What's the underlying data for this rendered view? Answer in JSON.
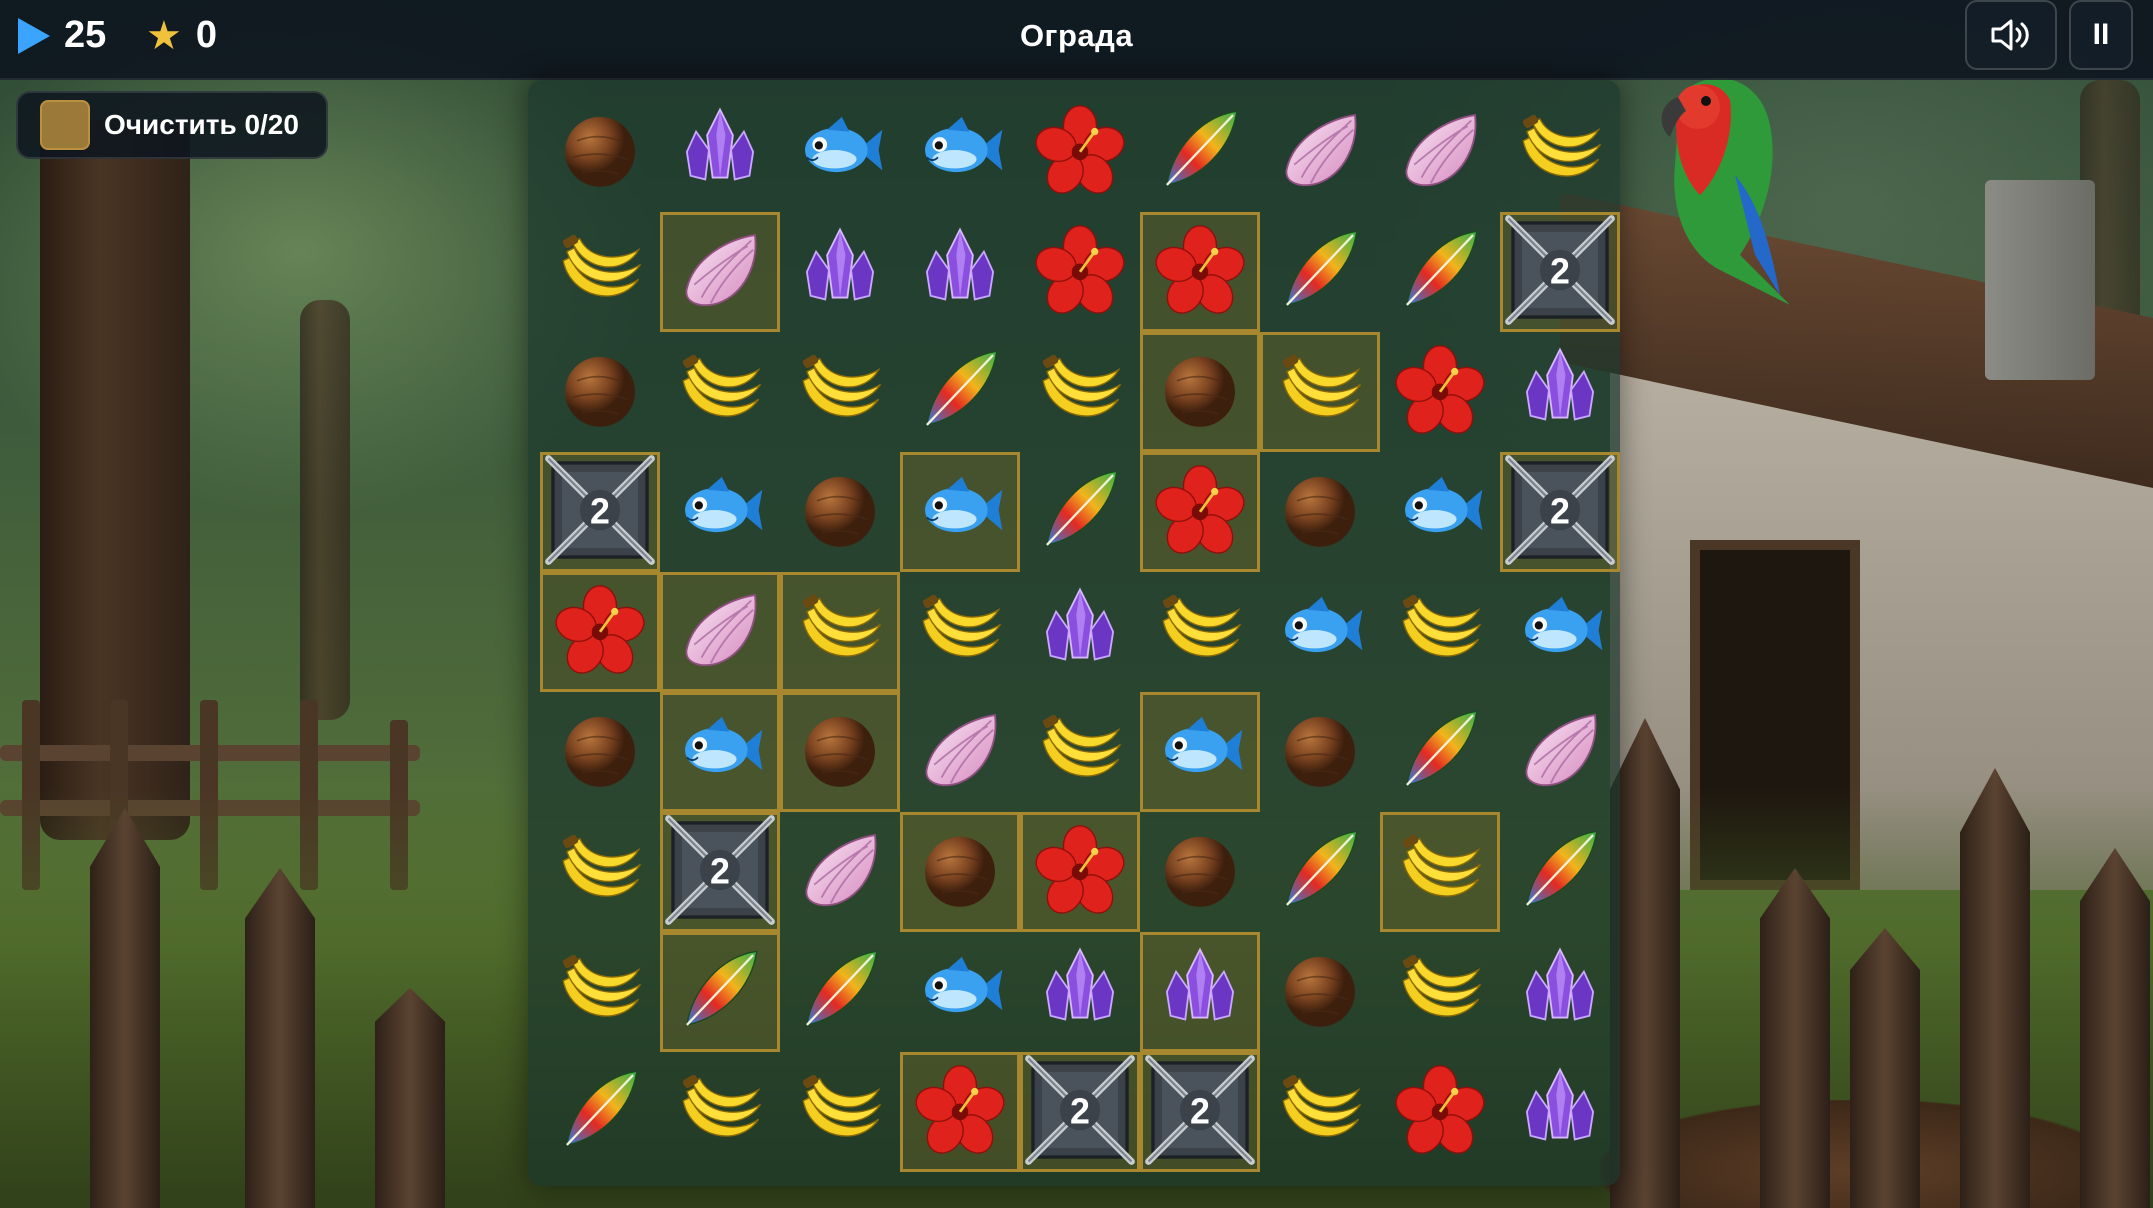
{
  "header": {
    "moves": "25",
    "moves_icon": "play-icon",
    "score": "0",
    "score_icon": "star-icon",
    "level_title": "Ограда",
    "sound_icon": "speaker-icon",
    "pause_label": "II"
  },
  "goal": {
    "label": "Очистить 0/20",
    "swatch_color": "#9b7a39"
  },
  "board": {
    "rows": 9,
    "cols": 9,
    "grid": [
      [
        "coconut",
        "crystal",
        "fish",
        "fish",
        "hibiscus",
        "feather",
        "shell",
        "shell",
        "banana"
      ],
      [
        "banana",
        "shell",
        "crystal",
        "crystal",
        "hibiscus",
        "hibiscus",
        "feather",
        "feather",
        "chain"
      ],
      [
        "coconut",
        "banana",
        "banana",
        "feather",
        "banana",
        "coconut",
        "banana",
        "hibiscus",
        "crystal"
      ],
      [
        "chain",
        "fish",
        "coconut",
        "fish",
        "feather",
        "hibiscus",
        "coconut",
        "fish",
        "chain"
      ],
      [
        "hibiscus",
        "shell",
        "banana",
        "banana",
        "crystal",
        "banana",
        "fish",
        "banana",
        "fish"
      ],
      [
        "coconut",
        "fish",
        "coconut",
        "shell",
        "banana",
        "fish",
        "coconut",
        "feather",
        "shell"
      ],
      [
        "banana",
        "chain",
        "shell",
        "coconut",
        "hibiscus",
        "coconut",
        "feather",
        "banana",
        "feather"
      ],
      [
        "banana",
        "feather",
        "feather",
        "fish",
        "crystal",
        "crystal",
        "coconut",
        "banana",
        "crystal"
      ],
      [
        "feather",
        "banana",
        "banana",
        "hibiscus",
        "chain",
        "chain",
        "banana",
        "hibiscus",
        "crystal"
      ]
    ],
    "fenced": [
      [
        0,
        0,
        0,
        0,
        0,
        0,
        0,
        0,
        0
      ],
      [
        0,
        1,
        0,
        0,
        0,
        1,
        0,
        0,
        1
      ],
      [
        0,
        0,
        0,
        0,
        0,
        1,
        1,
        0,
        0
      ],
      [
        1,
        0,
        0,
        1,
        0,
        1,
        0,
        0,
        1
      ],
      [
        1,
        1,
        1,
        0,
        0,
        0,
        0,
        0,
        0
      ],
      [
        0,
        1,
        1,
        0,
        0,
        1,
        0,
        0,
        0
      ],
      [
        0,
        1,
        0,
        1,
        1,
        0,
        0,
        1,
        0
      ],
      [
        0,
        1,
        0,
        0,
        0,
        1,
        0,
        0,
        0
      ],
      [
        0,
        0,
        0,
        1,
        1,
        1,
        0,
        0,
        0
      ]
    ],
    "chain_count": "2"
  },
  "colors": {
    "accent_blue": "#3aa4ff",
    "star_gold": "#f0c23b",
    "fence_gold": "#a8882f"
  }
}
